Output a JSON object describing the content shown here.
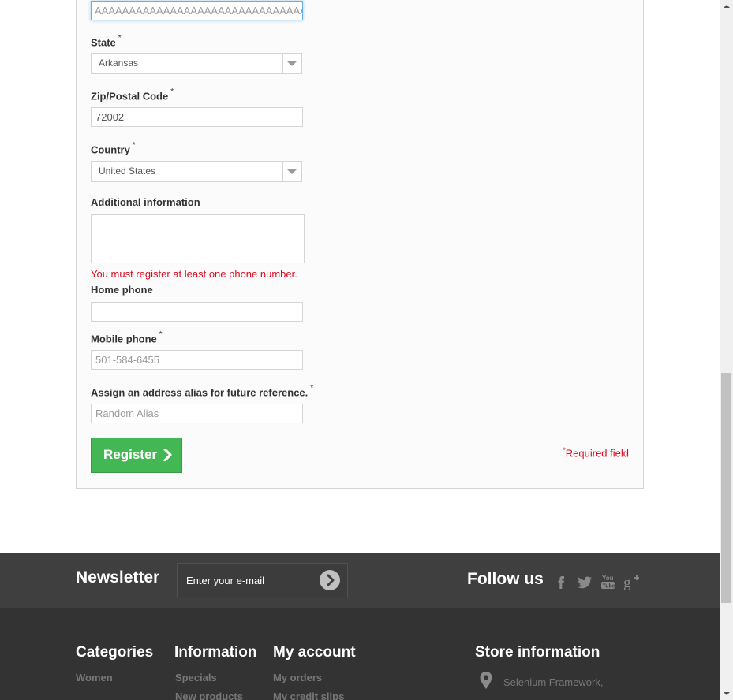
{
  "form": {
    "address_value": "AAAAAAAAAAAAAAAAAAAAAAAAAAAAAAAAAAAAAAAA",
    "state": {
      "label": "State",
      "required_mark": "*",
      "selected": "Arkansas"
    },
    "zip": {
      "label": "Zip/Postal Code",
      "required_mark": "*",
      "value": "72002"
    },
    "country": {
      "label": "Country",
      "required_mark": "*",
      "selected": "United States"
    },
    "additional_info": {
      "label": "Additional information",
      "value": ""
    },
    "error_message": "You must register at least one phone number.",
    "home_phone": {
      "label": "Home phone",
      "value": ""
    },
    "mobile_phone": {
      "label": "Mobile phone",
      "required_mark": "*",
      "value": "501-584-6455"
    },
    "alias": {
      "label": "Assign an address alias for future reference.",
      "required_mark": "*",
      "value": "Random Alias"
    },
    "register_button": "Register",
    "required_note_mark": "*",
    "required_note": "Required field"
  },
  "newsletter": {
    "title": "Newsletter",
    "input_placeholder": "Enter your e-mail",
    "follow_title": "Follow us",
    "social_icons": [
      "facebook-icon",
      "twitter-icon",
      "youtube-icon",
      "google-plus-icon"
    ]
  },
  "footer": {
    "categories": {
      "title": "Categories",
      "links": [
        "Women"
      ]
    },
    "information": {
      "title": "Information",
      "links": [
        "Specials",
        "New products"
      ]
    },
    "my_account": {
      "title": "My account",
      "links": [
        "My orders",
        "My credit slips"
      ]
    },
    "store": {
      "title": "Store information",
      "address": "Selenium Framework,"
    }
  },
  "colors": {
    "register_green": "#43b754",
    "error_red": "#e0091d",
    "newsletter_band": "#3f3f3f",
    "footer_bg": "#333333"
  }
}
